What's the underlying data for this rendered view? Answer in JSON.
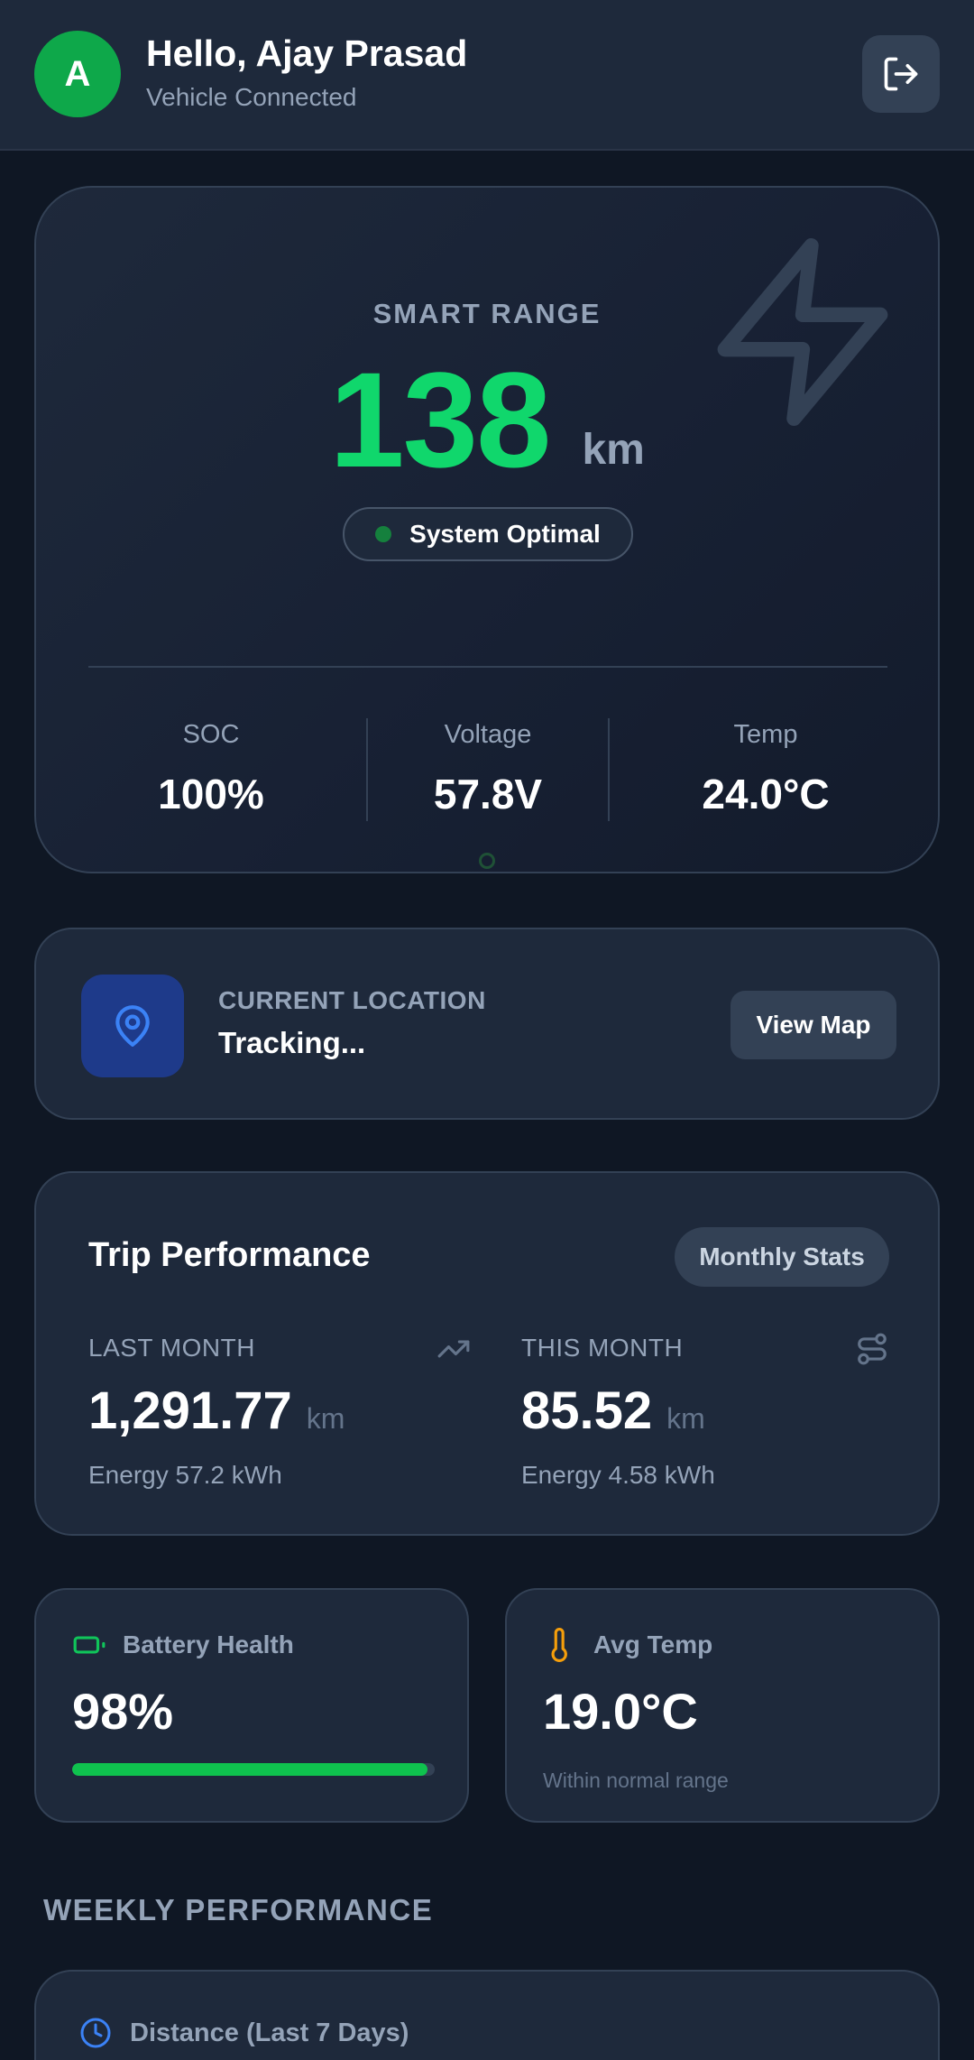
{
  "header": {
    "avatar_initial": "A",
    "greeting": "Hello, Ajay Prasad",
    "status": "Vehicle Connected",
    "logout_icon": "logout-icon"
  },
  "range": {
    "label": "SMART RANGE",
    "value": "138",
    "unit": "km",
    "status": "System Optimal",
    "decor_icon": "lightning-bolt-icon",
    "metrics": [
      {
        "label": "SOC",
        "value": "100%"
      },
      {
        "label": "Voltage",
        "value": "57.8V"
      },
      {
        "label": "Temp",
        "value": "24.0°C"
      }
    ]
  },
  "location": {
    "icon": "map-pin-icon",
    "label": "CURRENT LOCATION",
    "value": "Tracking...",
    "button": "View Map"
  },
  "trip": {
    "title": "Trip Performance",
    "button": "Monthly Stats",
    "last_month": {
      "label": "LAST MONTH",
      "value": "1,291.77",
      "unit": "km",
      "energy": "Energy 57.2 kWh",
      "icon": "trending-up-icon"
    },
    "this_month": {
      "label": "THIS MONTH",
      "value": "85.52",
      "unit": "km",
      "energy": "Energy 4.58 kWh",
      "icon": "route-icon"
    }
  },
  "battery": {
    "icon": "battery-icon",
    "label": "Battery Health",
    "value": "98%",
    "level": 0.98
  },
  "avg_temp": {
    "icon": "thermometer-icon",
    "label": "Avg Temp",
    "value": "19.0°C",
    "note": "Within normal range"
  },
  "weekly": {
    "title": "WEEKLY PERFORMANCE",
    "card_icon": "clock-icon",
    "card_label": "Distance (Last 7 Days)"
  },
  "colors": {
    "accent_green": "#10d76c",
    "avatar_green": "#0ea84a",
    "background": "#0f1724",
    "card": "#1e293b",
    "location_icon_blue": "#3b82f6",
    "thermometer_orange": "#f59e0b"
  }
}
